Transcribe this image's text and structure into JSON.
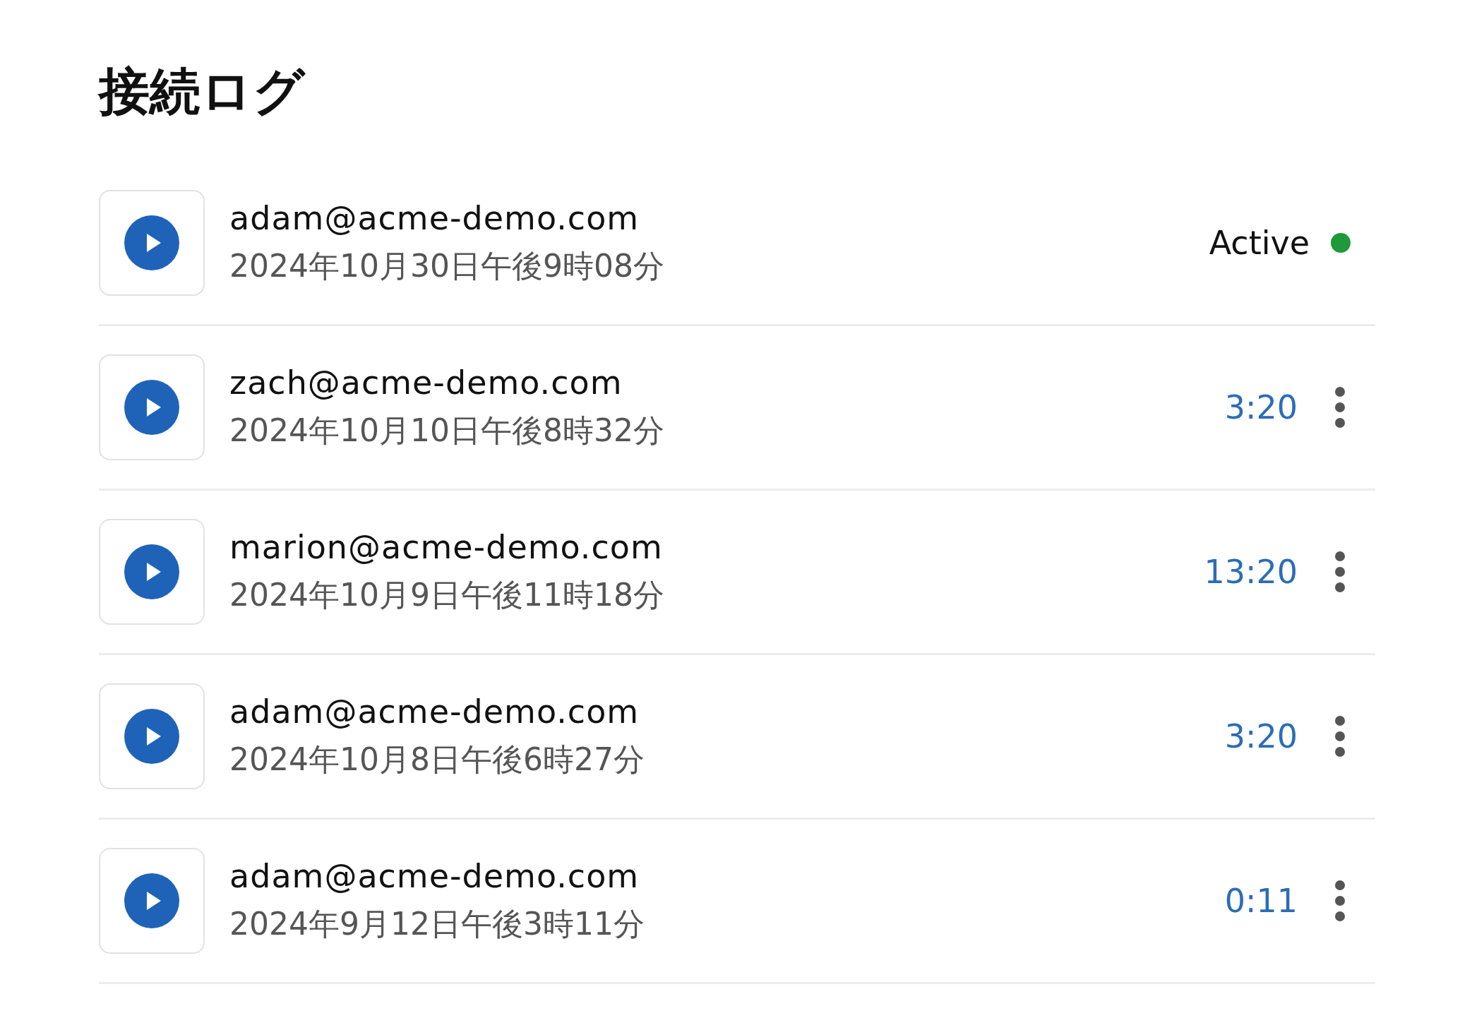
{
  "title": "接続ログ",
  "sessions": [
    {
      "email": "adam@acme-demo.com",
      "time": "2024年10月30日午後9時08分",
      "kind": "active",
      "status": "Active",
      "color": "#1e9a3a"
    },
    {
      "email": "zach@acme-demo.com",
      "time": "2024年10月10日午後8時32分",
      "kind": "duration",
      "status": "3:20"
    },
    {
      "email": "marion@acme-demo.com",
      "time": "2024年10月9日午後11時18分",
      "kind": "duration",
      "status": "13:20"
    },
    {
      "email": "adam@acme-demo.com",
      "time": "2024年10月8日午後6時27分",
      "kind": "duration",
      "status": "3:20"
    },
    {
      "email": "adam@acme-demo.com",
      "time": "2024年9月12日午後3時11分",
      "kind": "duration",
      "status": "0:11"
    }
  ]
}
